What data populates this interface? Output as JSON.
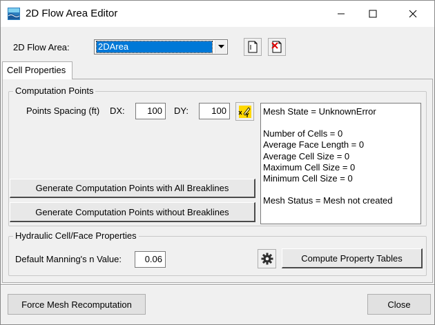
{
  "window": {
    "title": "2D Flow Area Editor"
  },
  "flow_area": {
    "label": "2D Flow Area:",
    "selected": "2DArea"
  },
  "tabs": [
    {
      "label": "Cell Properties",
      "active": true
    }
  ],
  "computation_points": {
    "group_title": "Computation Points",
    "spacing_label": "Points Spacing (ft)",
    "dx_label": "DX:",
    "dx_value": "100",
    "dy_label": "DY:",
    "dy_value": "100",
    "generate_with_breaklines": "Generate Computation Points with All Breaklines",
    "generate_without_breaklines": "Generate Computation Points without Breaklines"
  },
  "mesh_info": {
    "lines": [
      "Mesh State = UnknownError",
      "",
      "Number of Cells = 0",
      "Average Face Length = 0",
      "Average Cell Size = 0",
      "Maximum Cell Size = 0",
      "Minimum Cell Size = 0",
      "",
      "Mesh Status = Mesh not created"
    ]
  },
  "hydraulic": {
    "group_title": "Hydraulic Cell/Face Properties",
    "mannings_label": "Default Manning's n Value:",
    "mannings_value": "0.06",
    "compute_tables": "Compute Property Tables"
  },
  "footer": {
    "force_recompute": "Force Mesh Recomputation",
    "close": "Close"
  },
  "colors": {
    "selection": "#0078d7",
    "window_bg": "#f0f0f0",
    "accent_icon": "#d7a600"
  }
}
